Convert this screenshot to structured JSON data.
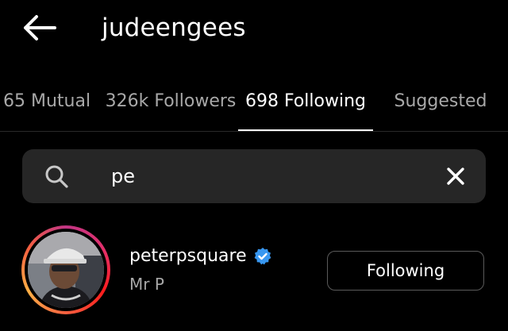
{
  "header": {
    "back_icon": "arrow-left-icon",
    "title": "judeengees"
  },
  "tabs": [
    {
      "label": "65 Mutual",
      "active": false
    },
    {
      "label": "326k Followers",
      "active": false
    },
    {
      "label": "698 Following",
      "active": true
    },
    {
      "label": "Suggested",
      "active": false
    }
  ],
  "search": {
    "icon": "search-icon",
    "value": "pe",
    "clear_icon": "close-icon"
  },
  "results": [
    {
      "username": "peterpsquare",
      "verified": true,
      "full_name": "Mr P",
      "button_label": "Following",
      "has_story_ring": true
    }
  ],
  "colors": {
    "background": "#000000",
    "search_bg": "#262626",
    "secondary_text": "#a8a8a8",
    "verified_blue": "#3897f0",
    "button_border": "#5a5a5a"
  }
}
